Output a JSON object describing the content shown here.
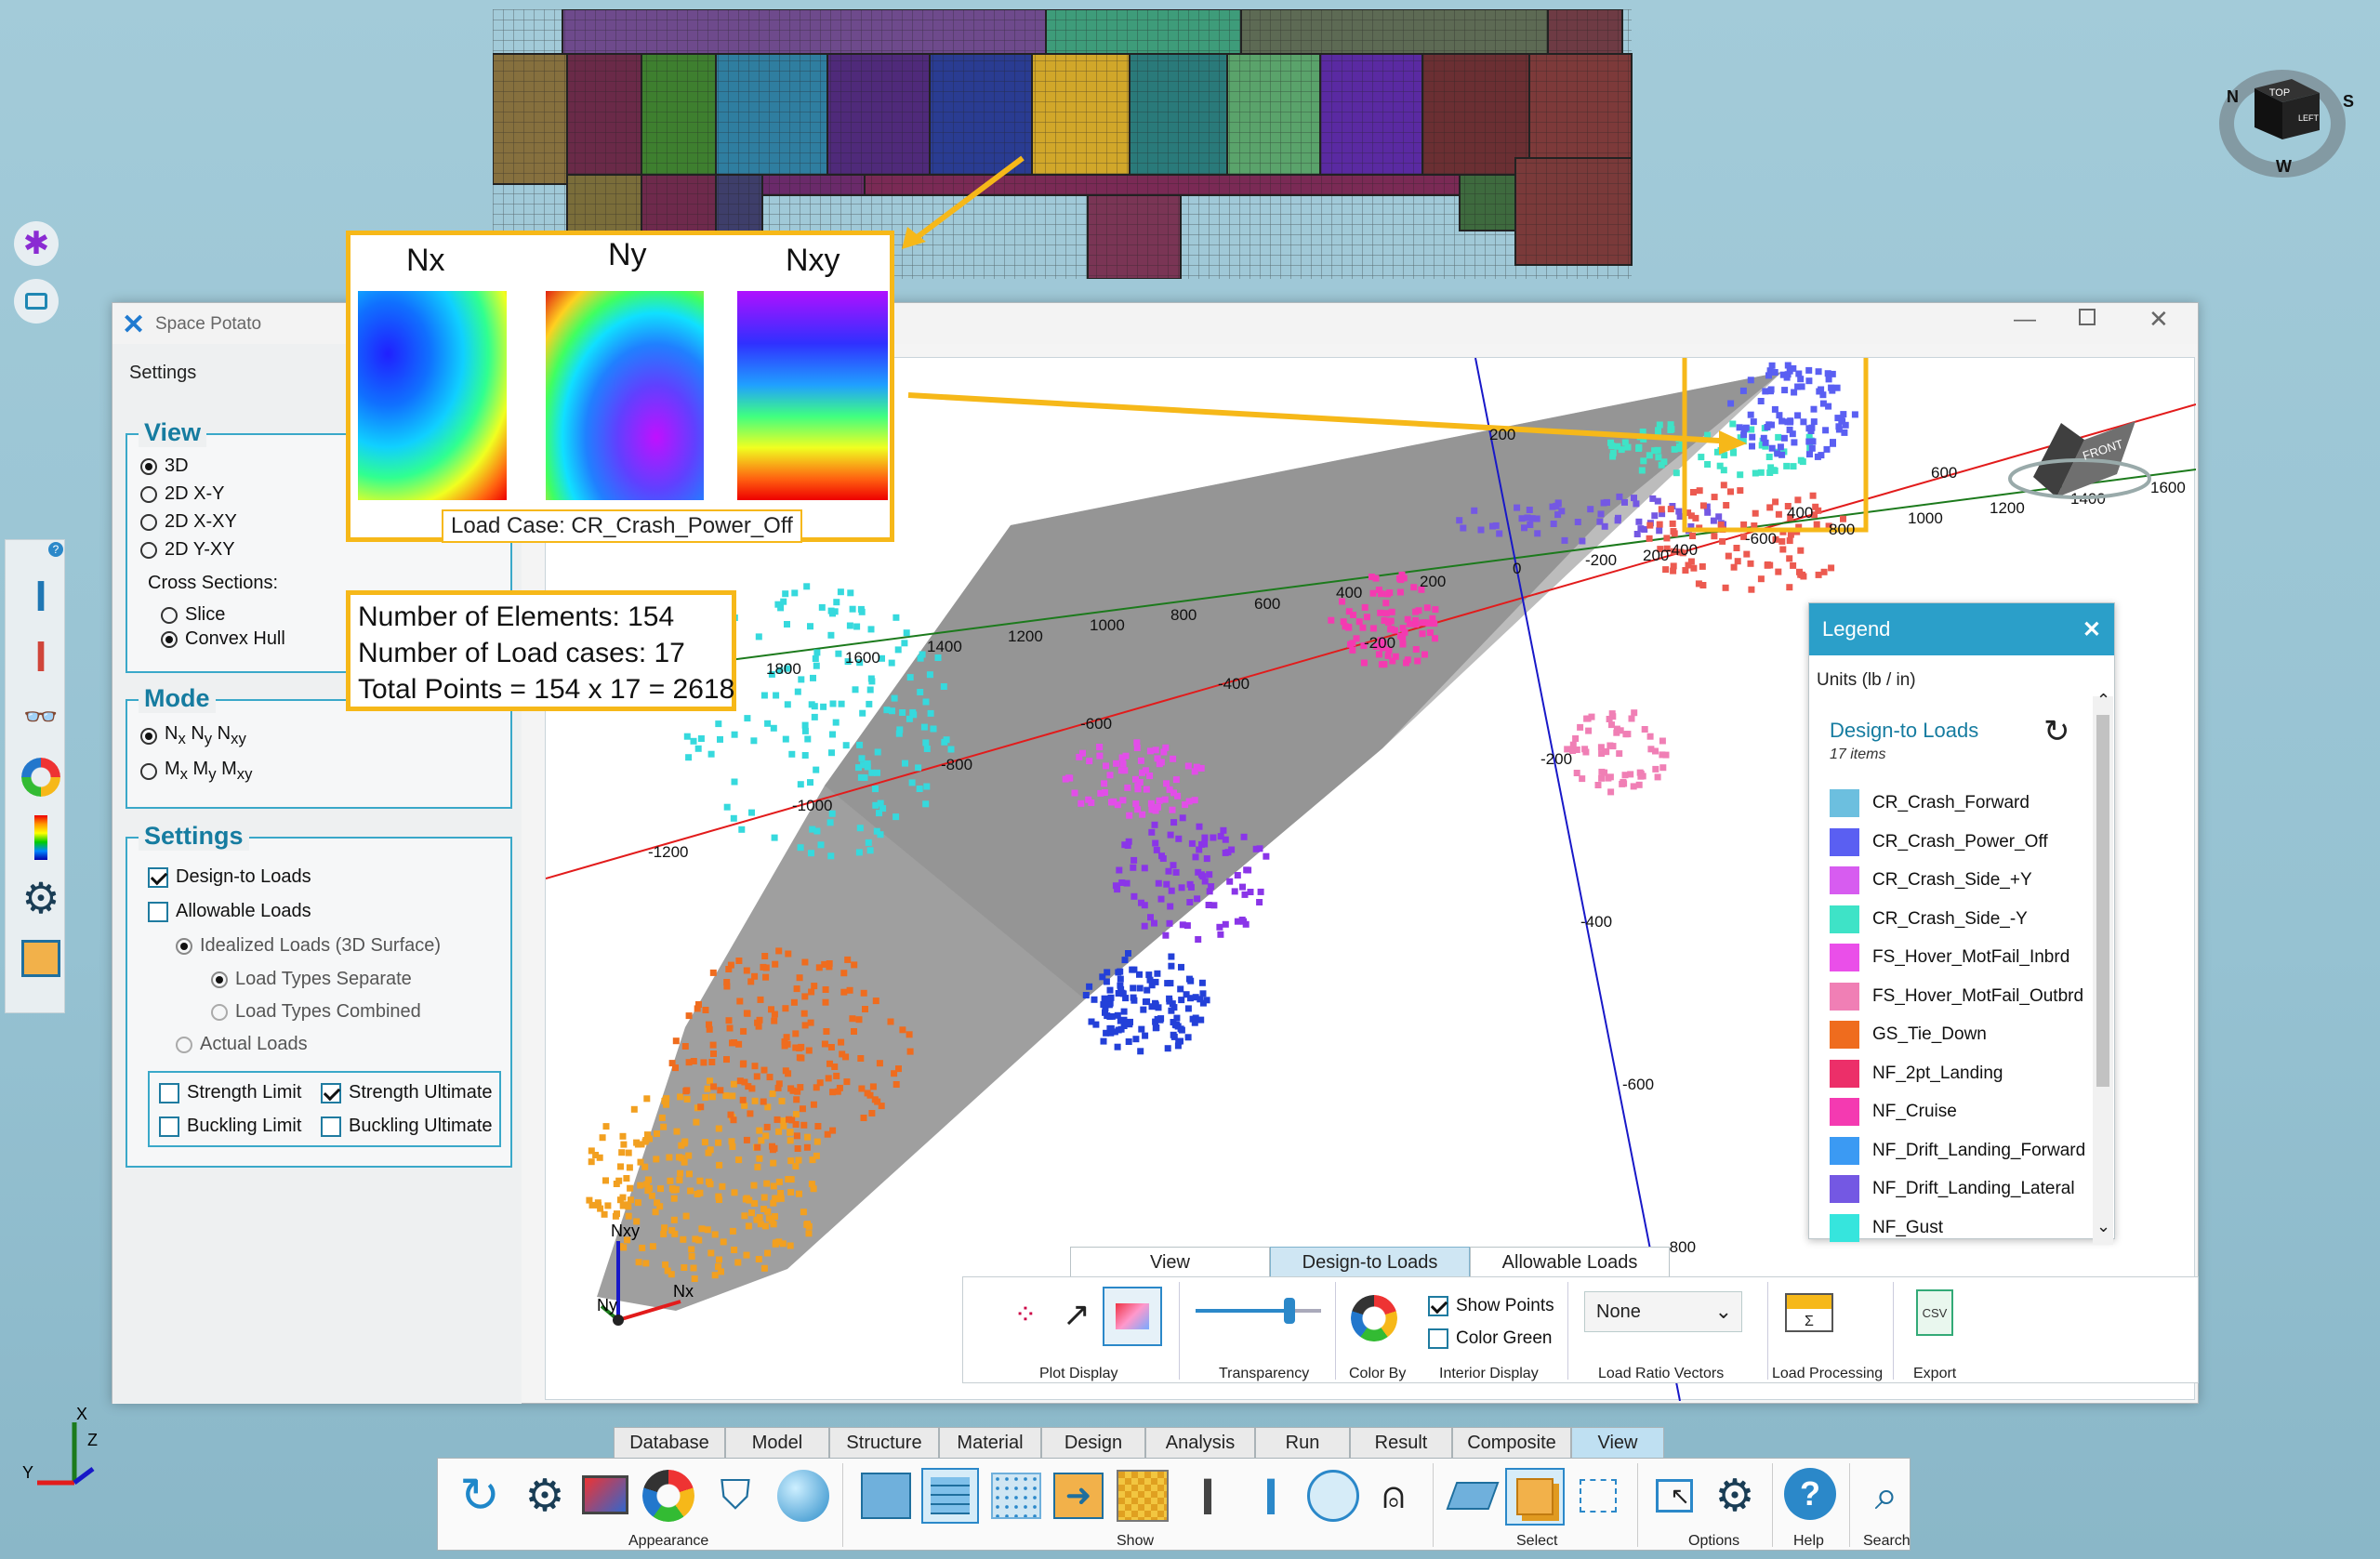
{
  "window": {
    "title": "Space Potato",
    "settings_label": "Settings"
  },
  "view_group": {
    "title": "View",
    "options": [
      "3D",
      "2D X-Y",
      "2D X-XY",
      "2D Y-XY"
    ],
    "selected": "3D",
    "cross_sections_label": "Cross Sections:",
    "cross_options": [
      "Slice",
      "Convex Hull"
    ],
    "cross_selected": "Convex Hull"
  },
  "mode_group": {
    "title": "Mode",
    "opt1": {
      "a": "N",
      "as": "x",
      "b": " N",
      "bs": "y",
      "c": " N",
      "cs": "xy"
    },
    "opt2": {
      "a": "M",
      "as": "x",
      "b": " M",
      "bs": "y",
      "c": " M",
      "cs": "xy"
    },
    "selected": "opt1"
  },
  "settings_group": {
    "title": "Settings",
    "design_to_loads": "Design-to Loads",
    "design_to_loads_checked": true,
    "allowable_loads": "Allowable Loads",
    "allowable_loads_checked": false,
    "idealized": "Idealized Loads (3D Surface)",
    "types_separate": "Load Types Separate",
    "types_combined": "Load Types Combined",
    "actual": "Actual Loads",
    "strength_limit": "Strength Limit",
    "strength_ultimate": "Strength Ultimate",
    "buckling_limit": "Buckling Limit",
    "buckling_ultimate": "Buckling Ultimate"
  },
  "callout": {
    "nx": "Nx",
    "ny": "Ny",
    "nxy": "Nxy",
    "load_case": "Load Case: CR_Crash_Power_Off"
  },
  "info": {
    "elements": "Number of Elements: 154",
    "load_cases": "Number of Load cases: 17",
    "total": "Total Points = 154 x 17 = 2618"
  },
  "legend": {
    "title": "Legend",
    "units": "Units (lb / in)",
    "section": "Design-to Loads",
    "count": "17 items",
    "items": [
      {
        "name": "CR_Crash_Forward",
        "color": "#6cbfdf"
      },
      {
        "name": "CR_Crash_Power_Off",
        "color": "#5a5ff2"
      },
      {
        "name": "CR_Crash_Side_+Y",
        "color": "#d75cf0"
      },
      {
        "name": "CR_Crash_Side_-Y",
        "color": "#3ee3c7"
      },
      {
        "name": "FS_Hover_MotFail_Inbrd",
        "color": "#ea4fe9"
      },
      {
        "name": "FS_Hover_MotFail_Outbrd",
        "color": "#f07fb5"
      },
      {
        "name": "GS_Tie_Down",
        "color": "#ef6c1e"
      },
      {
        "name": "NF_2pt_Landing",
        "color": "#ec2f69"
      },
      {
        "name": "NF_Cruise",
        "color": "#f43ab1"
      },
      {
        "name": "NF_Drift_Landing_Forward",
        "color": "#3b9af3"
      },
      {
        "name": "NF_Drift_Landing_Lateral",
        "color": "#7458e3"
      },
      {
        "name": "NF_Gust",
        "color": "#36e5dd"
      }
    ]
  },
  "axes": {
    "green": [
      "1800",
      "1600",
      "1400",
      "1200",
      "1000",
      "800",
      "600",
      "400",
      "200",
      "0",
      "-200",
      "-400",
      "-600",
      "800",
      "1000",
      "1200",
      "1400",
      "1600"
    ],
    "red": [
      "-1200",
      "-1000",
      "-800",
      "-600",
      "-400",
      "-200",
      "200",
      "400",
      "600"
    ],
    "blue": [
      "200",
      "-200",
      "-400",
      "-600",
      "-800"
    ],
    "triad": {
      "nxy": "Nxy",
      "ny": "Ny",
      "nx": "Nx"
    }
  },
  "viewcube": {
    "front": "FRONT",
    "top": "TOP",
    "left": "LEFT",
    "n": "N",
    "s": "S",
    "w": "W"
  },
  "plot_tabs": [
    "View",
    "Design-to Loads",
    "Allowable Loads"
  ],
  "plot_tab_active": "Design-to Loads",
  "ribbon": {
    "plot_display": "Plot Display",
    "transparency": "Transparency",
    "color_by": "Color By",
    "show_points": "Show Points",
    "color_green": "Color Green",
    "interior_display": "Interior Display",
    "ratio_value": "None",
    "ratio_label": "Load Ratio Vectors",
    "processing": "Load Processing",
    "export": "Export",
    "transparency_level": 0.75
  },
  "bottom_tabs": [
    "Database",
    "Model",
    "Structure",
    "Material",
    "Design",
    "Analysis",
    "Run",
    "Result",
    "Composite",
    "View"
  ],
  "bottom_tab_active": "View",
  "bottom_groups": [
    "Appearance",
    "Show",
    "Select",
    "Options",
    "Help",
    "Search"
  ],
  "corner_axes": {
    "x": "X",
    "y": "Y",
    "z": "Z"
  }
}
